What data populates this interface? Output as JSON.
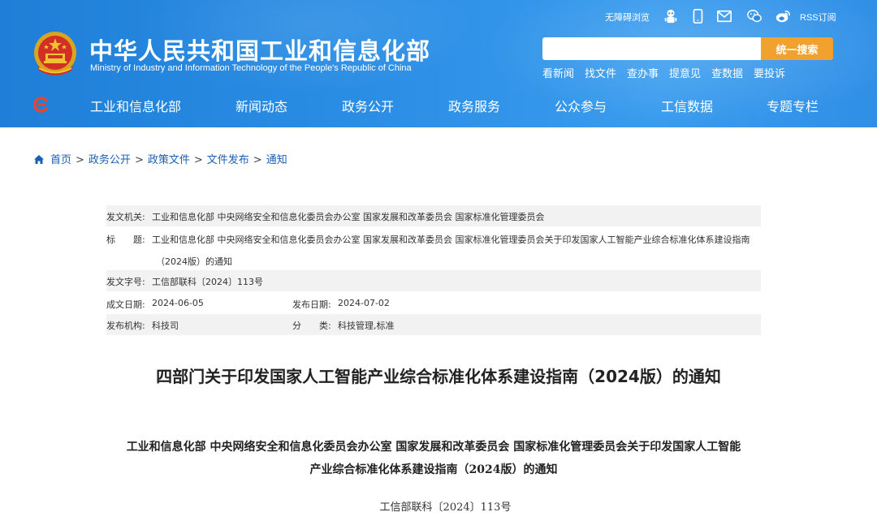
{
  "header": {
    "title": "中华人民共和国工业和信息化部",
    "subtitle": "Ministry of Industry and Information Technology of the People's Republic of China",
    "accessibility_label": "无障碍浏览",
    "rss_label": "RSS订阅",
    "search": {
      "placeholder": "",
      "button_label": "统一搜索"
    },
    "quick_links": [
      "看新闻",
      "找文件",
      "查办事",
      "提意见",
      "查数据",
      "要投诉"
    ]
  },
  "nav": {
    "items": [
      "工业和信息化部",
      "新闻动态",
      "政务公开",
      "政务服务",
      "公众参与",
      "工信数据",
      "专题专栏"
    ]
  },
  "breadcrumb": [
    "首页",
    "政务公开",
    "政策文件",
    "文件发布",
    "通知"
  ],
  "meta": {
    "issuer_label": "发文机关:",
    "issuer_value": "工业和信息化部 中央网络安全和信息化委员会办公室 国家发展和改革委员会 国家标准化管理委员会",
    "title_label": "标　　题:",
    "title_value_line1": "工业和信息化部 中央网络安全和信息化委员会办公室 国家发展和改革委员会 国家标准化管理委员会关于印发国家人工智能产业综合标准化体系建设指南",
    "title_value_line2": "（2024版）的通知",
    "docno_label": "发文字号:",
    "docno_value": "工信部联科〔2024〕113号",
    "created_label": "成文日期:",
    "created_value": "2024-06-05",
    "published_label": "发布日期:",
    "published_value": "2024-07-02",
    "publisher_label": "发布机构:",
    "publisher_value": "科技司",
    "category_label": "分　　类:",
    "category_value": "科技管理,标准"
  },
  "document": {
    "title": "四部门关于印发国家人工智能产业综合标准化体系建设指南（2024版）的通知",
    "heading_line1": "工业和信息化部  中央网络安全和信息化委员会办公室  国家发展和改革委员会  国家标准化管理委员会关于印发国家人工智能",
    "heading_line2": "产业综合标准化体系建设指南（2024版）的通知",
    "number": "工信部联科〔2024〕113号"
  },
  "colors": {
    "header_blue": "#2a8de4",
    "search_button": "#f0a12e",
    "link_blue": "#1a5fb4",
    "row_shade": "#f2f2f2"
  },
  "icons": [
    "national-emblem-icon",
    "robot-accessibility-icon",
    "mobile-icon",
    "mail-icon",
    "wechat-icon",
    "weibo-icon",
    "site-logo-icon",
    "home-icon"
  ]
}
